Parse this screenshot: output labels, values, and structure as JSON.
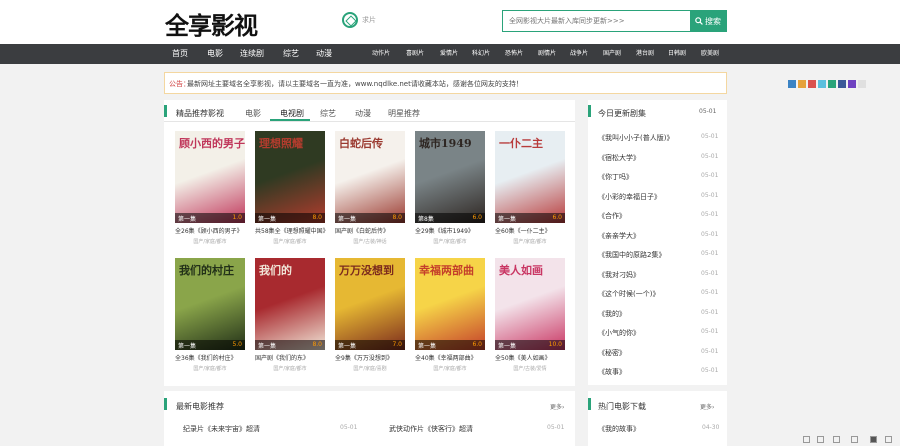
{
  "site": {
    "logo": "全享影视",
    "subbrand": "求片"
  },
  "search": {
    "placeholder": "全网影视大片最新入库同步更新>>>",
    "button": "搜索"
  },
  "nav": {
    "main": [
      "首页",
      "电影",
      "连续剧",
      "综艺",
      "动漫"
    ],
    "sub": [
      "动作片",
      "喜剧片",
      "爱情片",
      "科幻片",
      "恐怖片",
      "剧情片",
      "战争片",
      "国产剧",
      "港台剧",
      "日韩剧",
      "欧美剧"
    ]
  },
  "notice": {
    "label": "公告：",
    "text": "最新网址主要域名全享影视，请以主要域名一直为准，www.nqdlke.net请收藏本站，感谢各位网友的支持！"
  },
  "featured": {
    "title": "精品推荐影视",
    "tabs": [
      "电影",
      "电视剧",
      "综艺",
      "动漫",
      "明星推荐"
    ],
    "active_tab": "电视剧",
    "cards": [
      {
        "title": "全26集《顾小西的男子》",
        "actors": "国产/家庭/都市",
        "status": "第一集",
        "score": "1.0",
        "poster_text": "顾小西的男子",
        "colors": [
          "#f3f0e8",
          "#c0365a"
        ]
      },
      {
        "title": "共58集全《理想照耀中国》",
        "actors": "国产/家庭/都市",
        "status": "第一集",
        "score": "8.0",
        "poster_text": "理想照耀",
        "colors": [
          "#2f3a22",
          "#b33c2e"
        ]
      },
      {
        "title": "国产剧《白蛇后传》",
        "actors": "国产/古装/神话",
        "status": "第一集",
        "score": "8.0",
        "poster_text": "白蛇后传",
        "colors": [
          "#f5f1ec",
          "#9b3a30"
        ]
      },
      {
        "title": "全29集《城市1949》",
        "actors": "国产/家庭/都市",
        "status": "第8集",
        "score": "6.0",
        "poster_text": "城市1949",
        "colors": [
          "#7a8487",
          "#2e2622"
        ]
      },
      {
        "title": "全60集《一仆二主》",
        "actors": "国产/家庭/都市",
        "status": "第一集",
        "score": "6.0",
        "poster_text": "一仆二主",
        "colors": [
          "#e7eef2",
          "#b83b3b"
        ]
      },
      {
        "title": "全36集《我们的村庄》",
        "actors": "国产/家庭/都市",
        "status": "第一集",
        "score": "5.0",
        "poster_text": "我们的村庄",
        "colors": [
          "#8aa54a",
          "#223018"
        ]
      },
      {
        "title": "国产剧《我们的东》",
        "actors": "国产/家庭/都市",
        "status": "第一集",
        "score": "8.0",
        "poster_text": "我们的",
        "colors": [
          "#a82a2f",
          "#f1e6d8"
        ]
      },
      {
        "title": "全9集《万万没想到》",
        "actors": "国产/家庭/喜剧",
        "status": "第一集",
        "score": "7.0",
        "poster_text": "万万没想到",
        "colors": [
          "#e6b833",
          "#7b2a1d"
        ]
      },
      {
        "title": "全40集《幸福两部曲》",
        "actors": "国产/家庭/都市",
        "status": "第一集",
        "score": "6.0",
        "poster_text": "幸福两部曲",
        "colors": [
          "#f6d448",
          "#c43f2a"
        ]
      },
      {
        "title": "全50集《美人如画》",
        "actors": "国产/古装/爱情",
        "status": "第一集",
        "score": "10.0",
        "poster_text": "美人如画",
        "colors": [
          "#f3e3ea",
          "#c93663"
        ]
      }
    ]
  },
  "today": {
    "title": "今日更新剧集",
    "date_label": "05-01",
    "items": [
      "《我叫小小子(普人版)》",
      "《宿松大学》",
      "《你丁吗》",
      "《小彩的幸福日子》",
      "《合作》",
      "《亲亲学大》",
      "《我国中的原路2集》",
      "《我对刁妈》",
      "《这个时候(一个)》",
      "《我的》",
      "《小气的你》",
      "《秘密》",
      "《故事》"
    ],
    "dates": [
      "05-01",
      "05-01",
      "05-01",
      "05-01",
      "05-01",
      "05-01",
      "05-01",
      "05-01",
      "05-01",
      "05-01",
      "05-01",
      "05-01",
      "05-01"
    ]
  },
  "recent": {
    "title": "最新电影推荐",
    "more": "更多›",
    "items": [
      {
        "text": "纪录片《未来宇宙》超清",
        "date": "05-01"
      },
      {
        "text": "武侠动作片《侠客行》超清",
        "date": "05-01"
      }
    ]
  },
  "hot": {
    "title": "热门电影下载",
    "more": "更多›",
    "items": [
      {
        "text": "《我的故事》",
        "date": "04-30"
      }
    ]
  },
  "colors": {
    "accent": "#2aa37a",
    "nav_bg": "#3b3d40",
    "notice_label": "#d04040"
  }
}
